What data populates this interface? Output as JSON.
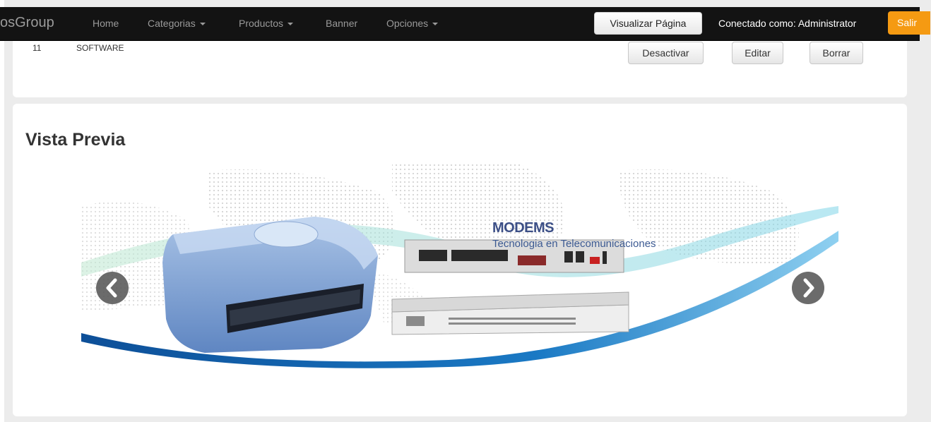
{
  "navbar": {
    "brand": "osGroup",
    "links": [
      {
        "label": "Home"
      },
      {
        "label": "Categorias",
        "dropdown": true
      },
      {
        "label": "Productos",
        "dropdown": true
      },
      {
        "label": "Banner"
      },
      {
        "label": "Opciones",
        "dropdown": true
      }
    ],
    "view_page_label": "Visualizar Página",
    "user_text": "Conectado como: Administrator",
    "logout_label": "Salir",
    "logout_accent": "#f59a12"
  },
  "category_row": {
    "id": "11",
    "name": "SOFTWARE",
    "deactivate_label": "Desactivar",
    "edit_label": "Editar",
    "delete_label": "Borrar"
  },
  "preview": {
    "title": "Vista Previa",
    "banner": {
      "heading": "MODEMS",
      "subheading": "Tecnologia en Telecomunicaciones"
    },
    "prev_icon": "chevron-left-icon",
    "next_icon": "chevron-right-icon"
  }
}
